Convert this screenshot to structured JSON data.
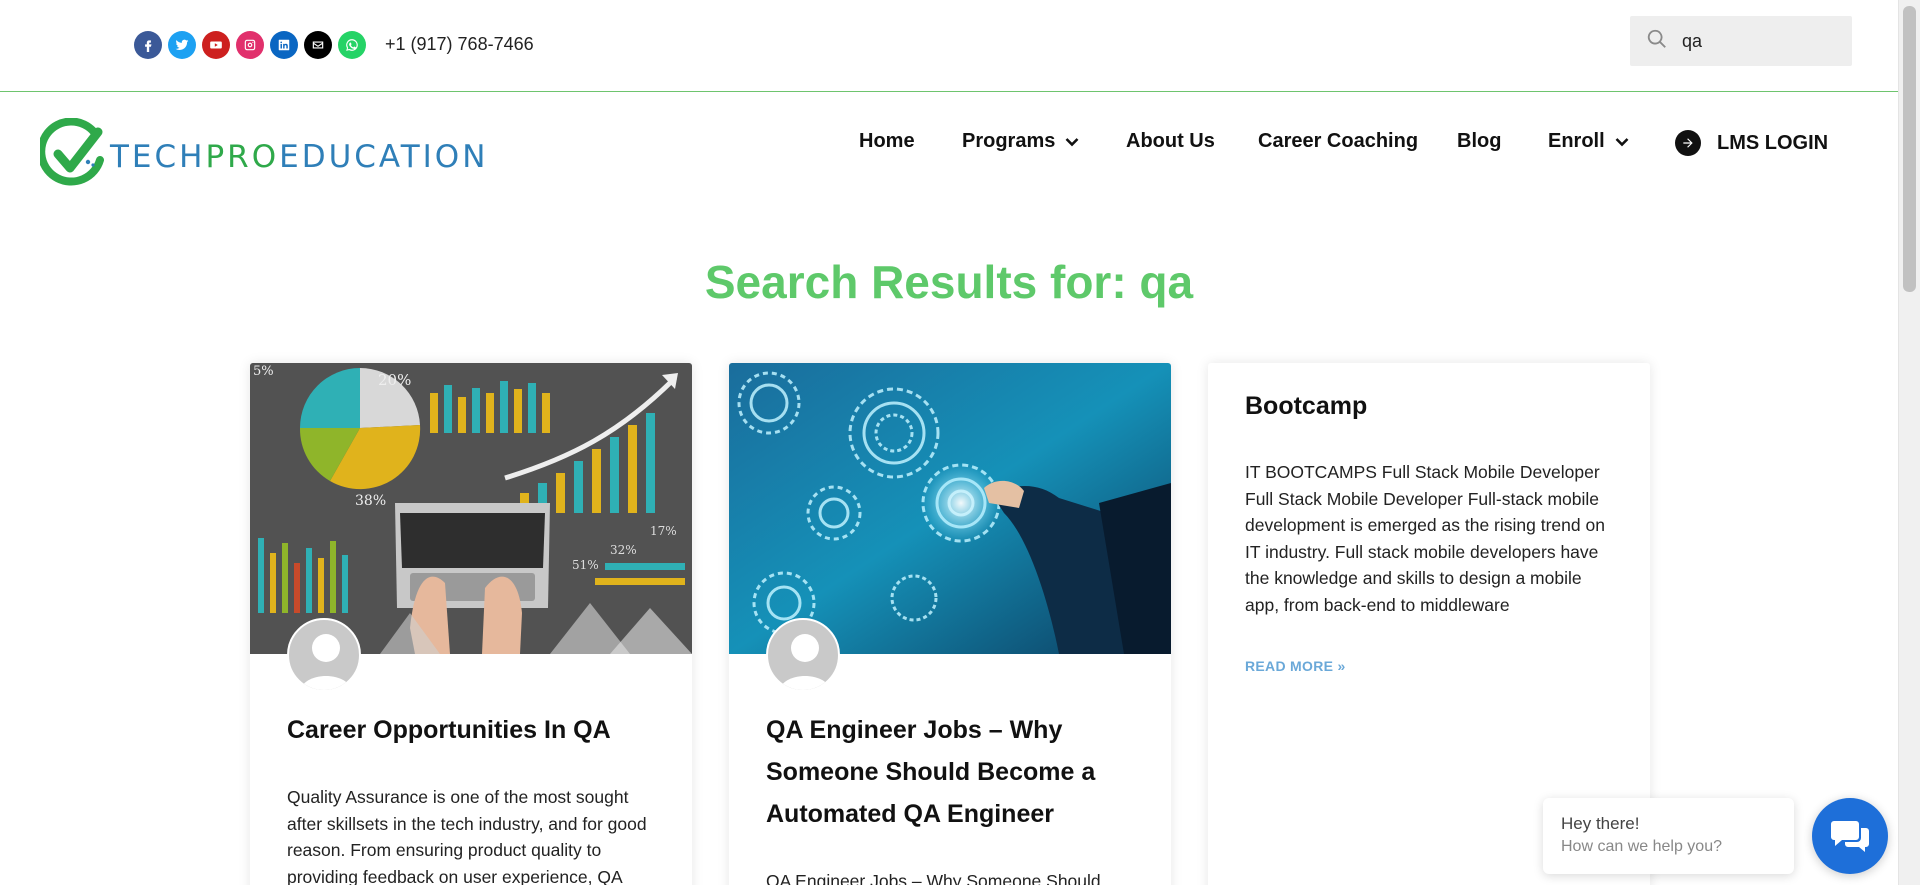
{
  "topbar": {
    "social_icons": [
      "facebook-icon",
      "twitter-icon",
      "youtube-icon",
      "instagram-icon",
      "linkedin-icon",
      "envelope-icon",
      "whatsapp-icon"
    ],
    "social_colors": [
      "#3b5998",
      "#1da1f2",
      "#cd201f",
      "#e1306c",
      "#0a66c2",
      "#000000",
      "#25d366"
    ],
    "phone": "+1 (917) 768-7466",
    "search": {
      "value": "qa"
    }
  },
  "logo": {
    "text_part1": "TECH",
    "text_part2": "PRO",
    "text_part3": "EDUCATION"
  },
  "nav": {
    "items": [
      {
        "label": "Home",
        "has_dropdown": false
      },
      {
        "label": "Programs",
        "has_dropdown": true
      },
      {
        "label": "About Us",
        "has_dropdown": false
      },
      {
        "label": "Career Coaching",
        "has_dropdown": false
      },
      {
        "label": "Blog",
        "has_dropdown": false
      },
      {
        "label": "Enroll",
        "has_dropdown": true
      }
    ],
    "lms_label": "LMS LOGIN"
  },
  "page": {
    "title": "Search Results for: qa"
  },
  "results": [
    {
      "title": "Career Opportunities In QA",
      "excerpt": "Quality Assurance is one of the most sought after skillsets in the tech industry, and for good reason. From ensuring product quality to providing feedback on user experience, QA",
      "image_labels": [
        "5%",
        "20%",
        "38%",
        "17%",
        "32%",
        "51%"
      ]
    },
    {
      "title": "QA Engineer Jobs – Why Someone Should Become a Automated QA Engineer",
      "excerpt": "QA Engineer Jobs – Why Someone Should"
    },
    {
      "title": "Bootcamp",
      "excerpt": "IT BOOTCAMPS Full Stack Mobile Developer Full Stack Mobile Developer Full-stack mobile development is emerged as the rising trend on IT industry. Full stack mobile developers have the knowledge and skills to design a mobile app, from back-end to middleware",
      "read_more": "READ MORE »"
    }
  ],
  "chat": {
    "line1": "Hey there!",
    "line2": "How can we help you?"
  },
  "colors": {
    "accent_green": "#5ec96a",
    "brand_blue": "#2f7fb8",
    "chat_blue": "#1e6fd9",
    "read_more": "#6aa8d8"
  }
}
